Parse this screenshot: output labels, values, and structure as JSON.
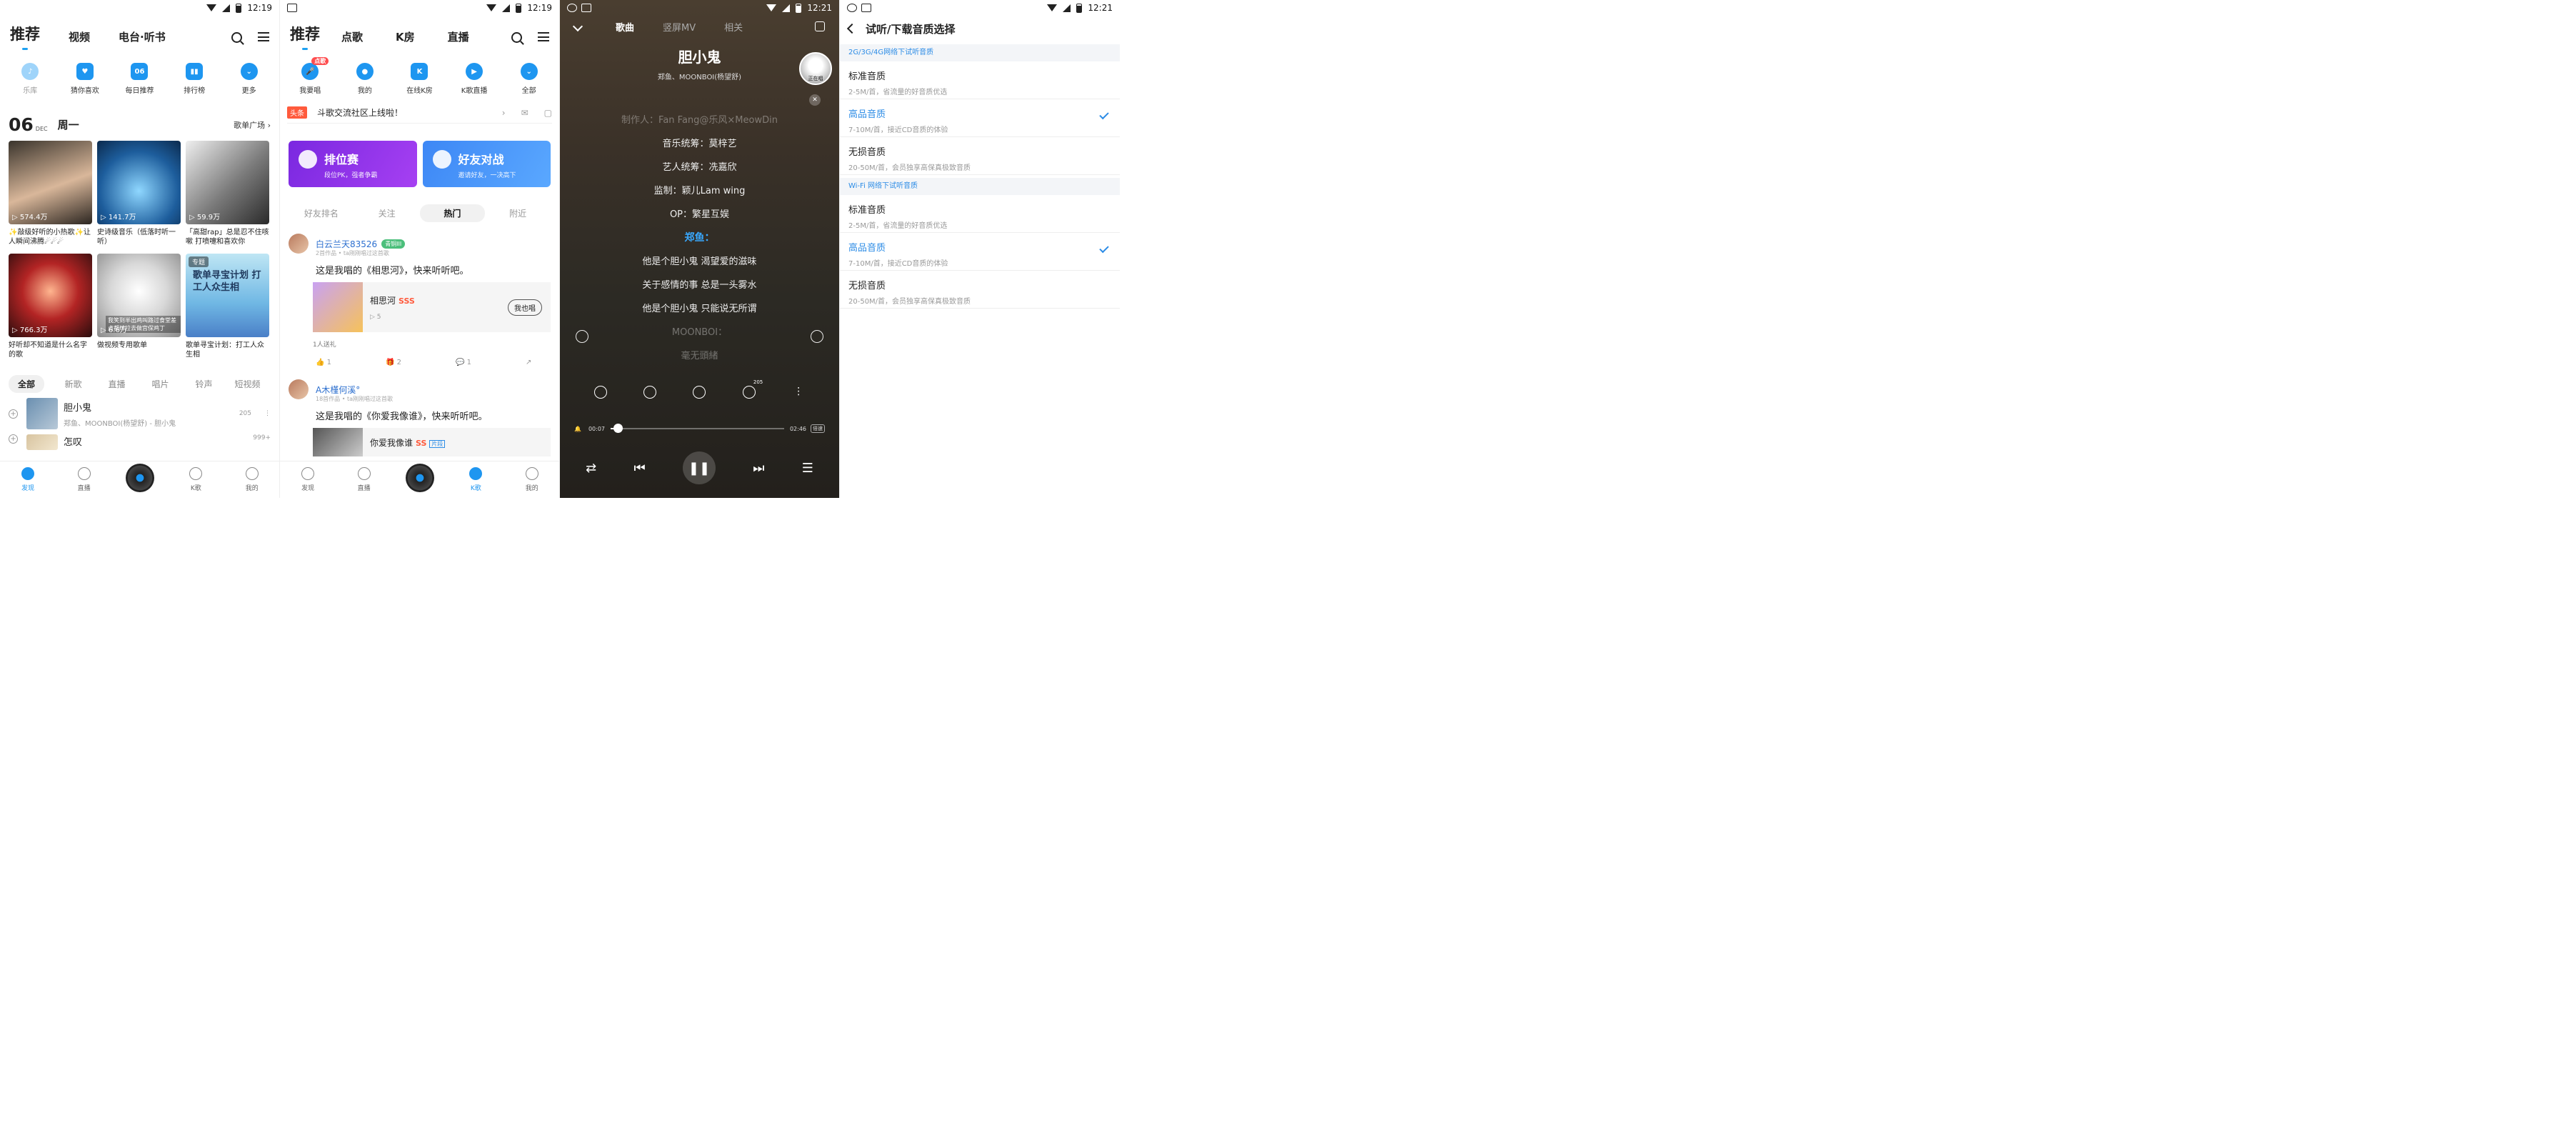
{
  "status": {
    "time1": "12:19",
    "time2": "12:19",
    "time3": "12:21",
    "time4": "12:21"
  },
  "p1": {
    "tabs": [
      "推荐",
      "视频",
      "电台·听书"
    ],
    "quick": [
      {
        "label": "乐库",
        "icon": "music-note-icon"
      },
      {
        "label": "猜你喜欢",
        "icon": "heart-radio-icon"
      },
      {
        "label": "每日推荐",
        "icon": "calendar-icon",
        "text": "06"
      },
      {
        "label": "排行榜",
        "icon": "chart-bars-icon"
      },
      {
        "label": "更多",
        "icon": "more-chevron-icon"
      }
    ],
    "date": {
      "day": "06",
      "month": "DEC",
      "weekday": "周一",
      "more": "歌单广场 ›"
    },
    "playlists": [
      {
        "plays": "▷ 574.4万",
        "title": "✨敲级好听的小热歌✨让人瞬间沸腾☄☄☄"
      },
      {
        "plays": "▷ 141.7万",
        "title": "史诗级音乐（低落时听一听）"
      },
      {
        "plays": "▷ 59.9万",
        "title": "「高甜rap」总是忍不住咳嗽 打喷嚏和喜欢你"
      },
      {
        "plays": "▷ 766.3万",
        "title": "好听却不知道是什么名字的歌"
      },
      {
        "plays": "▷ 6.6万",
        "title": "做视频专用歌单",
        "caption": "我笑到半出鸡叫路过食堂差点都绊拉去做宫保鸡丁"
      },
      {
        "plays": "",
        "title": "歌单寻宝计划：打工人众生相",
        "tag": "专题",
        "big": "歌单寻宝计划 打工人众生相"
      }
    ],
    "filters": [
      "全部",
      "新歌",
      "直播",
      "唱片",
      "铃声",
      "短视频"
    ],
    "songs": [
      {
        "title": "胆小鬼",
        "sub": "郑鱼、MOONBOI(杨望舒) - 胆小鬼",
        "count": "205"
      },
      {
        "title": "怎叹",
        "sub": "",
        "count": "999+"
      }
    ],
    "nav": [
      "发现",
      "直播",
      "",
      "K歌",
      "我的"
    ]
  },
  "p2": {
    "tabs": [
      "推荐",
      "点歌",
      "K房",
      "直播"
    ],
    "quick": [
      {
        "label": "我要唱",
        "badge": "点歌"
      },
      {
        "label": "我的"
      },
      {
        "label": "在线K房"
      },
      {
        "label": "K歌直播"
      },
      {
        "label": "全部"
      }
    ],
    "notice": {
      "tag": "头条",
      "text": "斗歌交流社区上线啦！",
      "mail_badge": "3"
    },
    "cards": [
      {
        "title": "排位赛",
        "sub": "段位PK，强者争霸"
      },
      {
        "title": "好友对战",
        "sub": "邀请好友，一决高下"
      }
    ],
    "subtabs": [
      "好友排名",
      "关注",
      "热门",
      "附近"
    ],
    "posts": [
      {
        "user": "白云兰天83526",
        "level": "青铜III",
        "meta": "2首作品 • ta刚刚唱过这首歌",
        "text": "这是我唱的《相思河》，快来听听吧。",
        "song": "相思河",
        "grade": "SSS",
        "plays": "▷ 5",
        "sing": "我也唱",
        "gift": "1人送礼",
        "likes": "1",
        "gifts": "2",
        "comments": "1"
      },
      {
        "user": "A木槿何溪°",
        "meta": "18首作品 • ta刚刚唱过这首歌",
        "text": "这是我唱的《你爱我像谁》，快来听听吧。",
        "song": "你爱我像谁",
        "grade": "SS",
        "tag": "片段"
      }
    ],
    "nav": [
      "发现",
      "直播",
      "",
      "K歌",
      "我的"
    ]
  },
  "p3": {
    "tabs": [
      "歌曲",
      "竖屏MV",
      "相关"
    ],
    "title": "胆小鬼",
    "artist": "郑鱼、MOONBOI(杨望舒)",
    "now_playing": "正在唱",
    "lyrics": [
      {
        "text": "制作人：Fan Fang@乐风×MeowDin",
        "style": "fade"
      },
      {
        "text": "音乐统筹：莫梓艺",
        "style": ""
      },
      {
        "text": "艺人统筹：冼嘉欣",
        "style": ""
      },
      {
        "text": "监制：颖儿Lam wing",
        "style": ""
      },
      {
        "text": "OP：繁星互娱",
        "style": ""
      },
      {
        "text": "郑鱼：",
        "style": "hl"
      },
      {
        "text": "他是个胆小鬼 渴望爱的滋味",
        "style": ""
      },
      {
        "text": "关于感情的事 总是一头雾水",
        "style": ""
      },
      {
        "text": "他是个胆小鬼 只能说无所谓",
        "style": ""
      },
      {
        "text": "MOONBOI：",
        "style": "fade"
      },
      {
        "text": "毫无頭緒",
        "style": "fade"
      }
    ],
    "comment_count": "205",
    "elapsed": "00:07",
    "duration": "02:46",
    "progress": 0.04,
    "speed": "倍速"
  },
  "p4": {
    "title": "试听/下载音质选择",
    "sections": [
      {
        "header": "2G/3G/4G网络下试听音质",
        "options": [
          {
            "name": "标准音质",
            "desc": "2-5M/首，省流量的好音质优选",
            "selected": false
          },
          {
            "name": "高品音质",
            "desc": "7-10M/首，接近CD音质的体验",
            "selected": true
          },
          {
            "name": "无损音质",
            "desc": "20-50M/首，会员独享高保真极致音质",
            "selected": false
          }
        ]
      },
      {
        "header": "Wi-Fi 网络下试听音质",
        "options": [
          {
            "name": "标准音质",
            "desc": "2-5M/首，省流量的好音质优选",
            "selected": false
          },
          {
            "name": "高品音质",
            "desc": "7-10M/首，接近CD音质的体验",
            "selected": true
          },
          {
            "name": "无损音质",
            "desc": "20-50M/首，会员独享高保真极致音质",
            "selected": false
          }
        ]
      }
    ]
  },
  "colors": {
    "accent": "#1e96f0",
    "highlight": "#39a9ff",
    "link": "#2c8ce6"
  }
}
